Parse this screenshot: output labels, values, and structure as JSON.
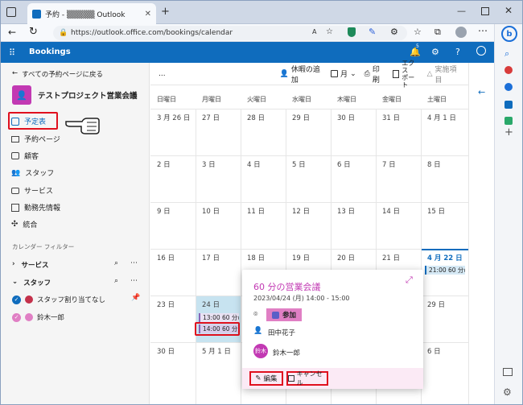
{
  "browser": {
    "tab_title": "予約 - ▒▒▒▒▒ Outlook",
    "url": "https://outlook.office.com/bookings/calendar",
    "reader_label": "A",
    "notif_count": "5"
  },
  "app": {
    "name": "Bookings"
  },
  "sidebar": {
    "back_label": "すべての予約ページに戻る",
    "business_name": "テストプロジェクト営業会議",
    "items": [
      {
        "label": "予定表"
      },
      {
        "label": "予約ページ"
      },
      {
        "label": "顧客"
      },
      {
        "label": "スタッフ"
      },
      {
        "label": "サービス"
      },
      {
        "label": "勤務先情報"
      },
      {
        "label": "統合"
      }
    ],
    "filter_heading": "カレンダー フィルター",
    "services_label": "サービス",
    "staff_label": "スタッフ",
    "unassigned_label": "スタッフ割り当てなし",
    "staff_member": "鈴木一郎"
  },
  "toolbar": {
    "more": "...",
    "add_timeoff": "休暇の追加",
    "month_view": "月",
    "print": "印刷",
    "export": "エクスポート",
    "export_line1": "エクス",
    "export_line2": "ポート",
    "attendance": "実施項目"
  },
  "calendar": {
    "weekdays": [
      "日曜日",
      "月曜日",
      "火曜日",
      "水曜日",
      "木曜日",
      "金曜日",
      "土曜日"
    ],
    "weeks": [
      [
        "3 月 26 日",
        "27 日",
        "28 日",
        "29 日",
        "30 日",
        "31 日",
        "4 月 1 日"
      ],
      [
        "2 日",
        "3 日",
        "4 日",
        "5 日",
        "6 日",
        "7 日",
        "8 日"
      ],
      [
        "9 日",
        "10 日",
        "11 日",
        "12 日",
        "13 日",
        "14 日",
        "15 日"
      ],
      [
        "16 日",
        "17 日",
        "18 日",
        "19 日",
        "20 日",
        "21 日",
        "4 月 22 日"
      ],
      [
        "23 日",
        "24 日",
        "25 日",
        "26 日",
        "27 日",
        "28 日",
        "29 日"
      ],
      [
        "30 日",
        "5 月 1 日",
        "2 日",
        "3 日",
        "4 日",
        "5 日",
        "6 日"
      ]
    ],
    "events": {
      "sat22": "21:00 60 分の",
      "mon24_a": "13:00 60 分の",
      "mon24_b": "14:00 60 分の"
    }
  },
  "popup": {
    "title": "60 分の営業会議",
    "datetime": "2023/04/24 (月) 14:00 - 15:00",
    "join_label": "参加",
    "customer": "田中花子",
    "staff_avatar": "鈴木",
    "staff_name": "鈴木一郎",
    "edit_label": "編集",
    "cancel_label": "キャンセル"
  },
  "colors": {
    "accent": "#0f6cbd",
    "brand_pink": "#c239b3",
    "highlight": "#e0101e",
    "teams": "#5b5fc7"
  }
}
